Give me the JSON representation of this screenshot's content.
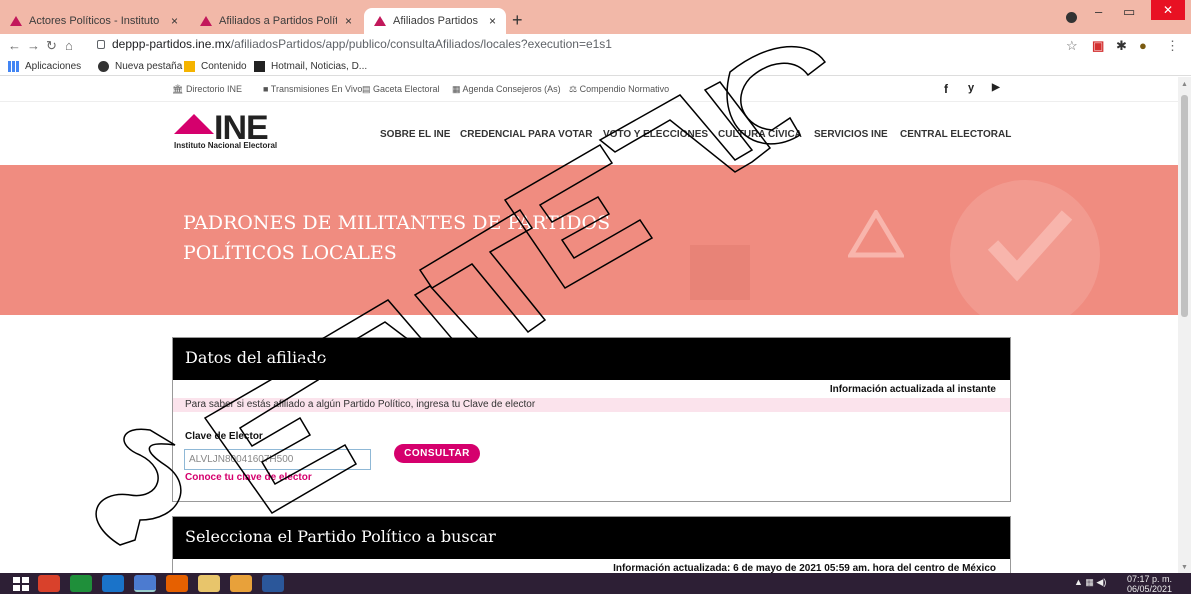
{
  "browser": {
    "tabs": [
      {
        "label": "Actores Políticos - Instituto Nacio",
        "active": false
      },
      {
        "label": "Afiliados a Partidos Políticos Nac",
        "active": false
      },
      {
        "label": "Afiliados Partidos",
        "active": true
      }
    ],
    "tab_close": "×",
    "new_tab": "+",
    "url_host": "deppp-partidos.ine.mx",
    "url_path": "/afiliadosPartidos/app/publico/consultaAfiliados/locales?execution=e1s1",
    "bookmarks": [
      "Aplicaciones",
      "Nueva pestaña",
      "Contenido",
      "Hotmail, Noticias, D..."
    ]
  },
  "ine_strip": {
    "links": [
      "Directorio INE",
      "Transmisiones En Vivo",
      "Gaceta Electoral",
      "Agenda Consejeros (As)",
      "Compendio Normativo"
    ],
    "social": [
      "f",
      "y",
      "▶"
    ]
  },
  "header": {
    "logo_text": "INE",
    "logo_sub": "Instituto Nacional Electoral",
    "nav": [
      "SOBRE EL INE",
      "CREDENCIAL PARA VOTAR",
      "VOTO Y ELECCIONES",
      "CULTURA CÍVICA",
      "SERVICIOS INE",
      "CENTRAL ELECTORAL"
    ]
  },
  "banner": {
    "title_line1": "PADRONES DE MILITANTES DE PARTIDOS",
    "title_line2": "POLÍTICOS LOCALES"
  },
  "afiliado_panel": {
    "title": "Datos del afiliado",
    "updated": "Información actualizada al instante",
    "instruction": "Para saber si estás afiliado a algún Partido Político, ingresa tu Clave de elector",
    "field_label": "Clave de Elector",
    "field_value": "ALVLJN80041607H500",
    "button": "CONSULTAR",
    "link": "Conoce tu clave de elector"
  },
  "partido_panel": {
    "title": "Selecciona el Partido Político a buscar",
    "updated": "Información actualizada: 6 de mayo de 2021 05:59 am. hora del centro de México"
  },
  "taskbar": {
    "time": "07:17 p. m.",
    "date": "06/05/2021"
  },
  "watermark": {
    "text": "SENTENCIA"
  },
  "colors": {
    "brand": "#d5006d",
    "banner": "#f08c80",
    "tabstrip": "#f2b8a8"
  }
}
